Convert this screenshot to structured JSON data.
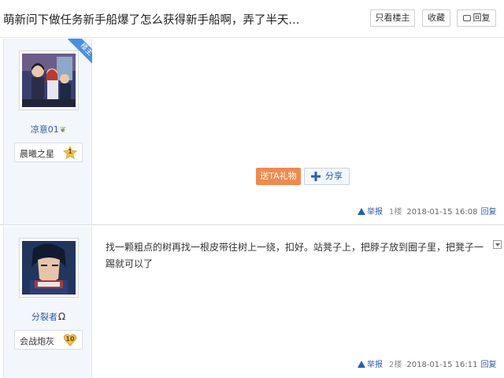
{
  "header": {
    "title": "萌新问下做任务新手船爆了怎么获得新手船啊，弄了半天...",
    "only_op_label": "只看楼主",
    "favorite_label": "收藏",
    "reply_label": "回复"
  },
  "posts": [
    {
      "op_ribbon": "楼主",
      "username": "凉意01",
      "badge_text": "晨曦之星",
      "badge_level": "1",
      "content": "",
      "gift_label": "送TA礼物",
      "share_label": "分享",
      "report_label": "举报",
      "floor": "1楼",
      "time": "2018-01-15 16:08",
      "reply_label": "回复"
    },
    {
      "username": "分裂者",
      "username_suffix": "Ω",
      "badge_text": "会战炮灰",
      "badge_level": "10",
      "content": "找一颗粗点的树再找一根皮带往树上一绕，扣好。站凳子上，把脖子放到圈子里，把凳子一踢就可以了",
      "report_label": "举报",
      "floor": "2楼",
      "time": "2018-01-15 16:11",
      "reply_label": "回复"
    }
  ],
  "colors": {
    "accent_blue": "#2a5db0",
    "gift_orange": "#f08a4b",
    "ribbon_blue": "#4a90e2",
    "sidebar_bg": "#f3f6fb"
  }
}
